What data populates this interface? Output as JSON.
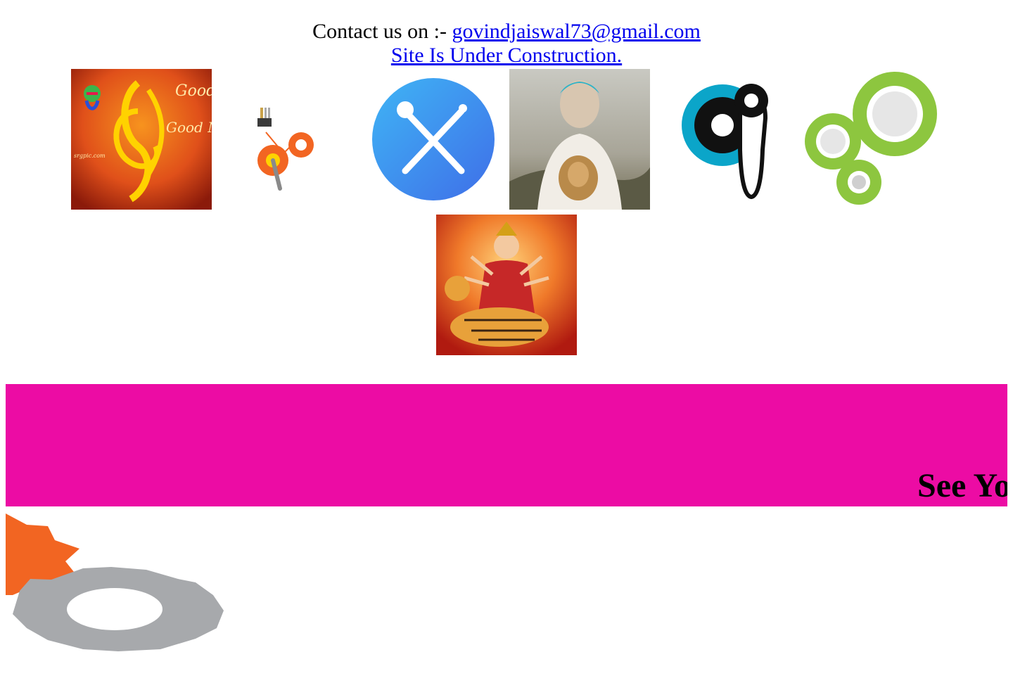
{
  "header": {
    "contact_prefix": "Contact us on :- ",
    "contact_email": "govindjaiswal73@gmail.com",
    "construction_notice": "Site Is Under Construction."
  },
  "images": [
    {
      "name": "good-morning-ganesha-image",
      "caption": "Good Morning",
      "watermark": "srgpic.com"
    },
    {
      "name": "tools-gears-image"
    },
    {
      "name": "wrench-screwdriver-app-image"
    },
    {
      "name": "person-with-lion-photo"
    },
    {
      "name": "gear-wrench-icon-image"
    },
    {
      "name": "green-gears-image"
    },
    {
      "name": "durga-on-tiger-image"
    }
  ],
  "banner": {
    "marquee_text": "See Yo",
    "background_color": "#ec0ca4"
  },
  "colors": {
    "link": "#0000ee",
    "gear_orange": "#f26522",
    "gear_grey": "#a7a9ac",
    "gear_green": "#8dc63f",
    "gear_teal": "#0ba5c9"
  }
}
